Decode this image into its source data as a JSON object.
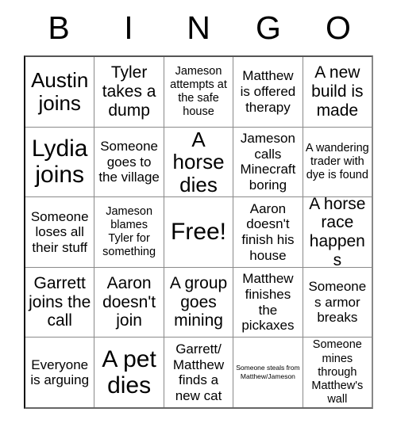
{
  "card": {
    "title": "BINGO",
    "header_letters": [
      "B",
      "I",
      "N",
      "G",
      "O"
    ],
    "free_space_label": "Free!",
    "border_color": "#8a8a8a",
    "text_color": "#000000",
    "background_color": "#ffffff",
    "rows": [
      {
        "cells": [
          {
            "text": "Austin joins",
            "size": "fs-xl"
          },
          {
            "text": "Tyler takes a dump",
            "size": "fs-lg"
          },
          {
            "text": "Jameson attempts at the safe house",
            "size": "fs-sm"
          },
          {
            "text": "Matthew is offered therapy",
            "size": "fs-md"
          },
          {
            "text": "A new build is made",
            "size": "fs-lg"
          }
        ]
      },
      {
        "cells": [
          {
            "text": "Lydia joins",
            "size": "fs-xxl"
          },
          {
            "text": "Someone goes to the village",
            "size": "fs-md"
          },
          {
            "text": "A horse dies",
            "size": "fs-xl"
          },
          {
            "text": "Jameson calls Minecraft boring",
            "size": "fs-md"
          },
          {
            "text": "A wandering trader with dye is found",
            "size": "fs-sm"
          }
        ]
      },
      {
        "cells": [
          {
            "text": "Someone loses all their stuff",
            "size": "fs-md"
          },
          {
            "text": "Jameson blames Tyler for something",
            "size": "fs-sm"
          },
          {
            "text": "Free!",
            "size": "fs-xxl"
          },
          {
            "text": "Aaron doesn't finish his house",
            "size": "fs-md"
          },
          {
            "text": "A horse race happens",
            "size": "fs-lg"
          }
        ]
      },
      {
        "cells": [
          {
            "text": "Garrett joins the call",
            "size": "fs-lg"
          },
          {
            "text": "Aaron doesn't join",
            "size": "fs-lg"
          },
          {
            "text": "A group goes mining",
            "size": "fs-lg"
          },
          {
            "text": "Matthew finishes the pickaxes",
            "size": "fs-md"
          },
          {
            "text": "Someones armor breaks",
            "size": "fs-md"
          }
        ]
      },
      {
        "cells": [
          {
            "text": "Everyone is arguing",
            "size": "fs-md"
          },
          {
            "text": "A pet dies",
            "size": "fs-xxl"
          },
          {
            "text": "Garrett/ Matthew finds a new cat",
            "size": "fs-md"
          },
          {
            "text": "Someone steals from Matthew/Jameson",
            "size": "fs-xxs"
          },
          {
            "text": "Someone mines through Matthew's wall",
            "size": "fs-sm"
          }
        ]
      }
    ]
  }
}
